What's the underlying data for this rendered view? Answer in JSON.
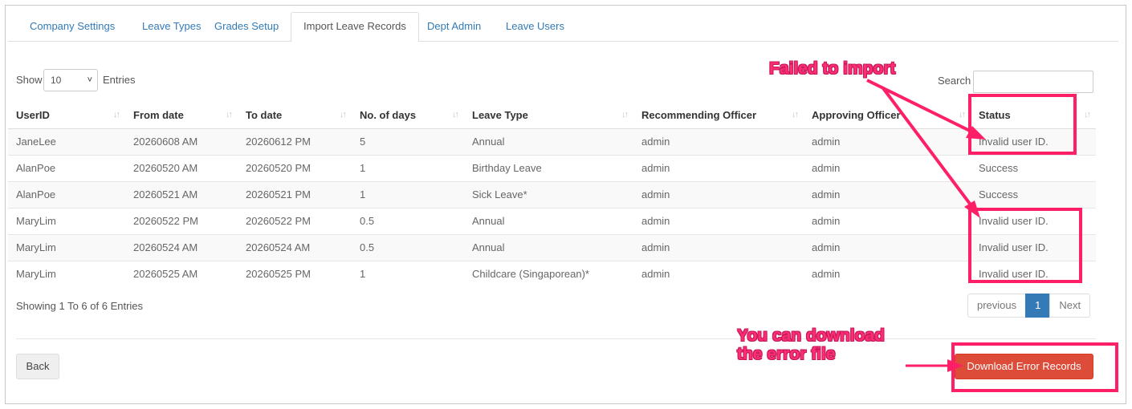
{
  "tabs": [
    {
      "label": "Company Settings",
      "active": false
    },
    {
      "label": "Leave Types",
      "active": false
    },
    {
      "label": "Grades Setup",
      "active": false
    },
    {
      "label": "Import Leave Records",
      "active": true
    },
    {
      "label": "Dept Admin",
      "active": false
    },
    {
      "label": "Leave Users",
      "active": false
    }
  ],
  "length_control": {
    "label_before": "Show",
    "value": "10",
    "label_after": "Entries"
  },
  "search": {
    "label": "Search",
    "value": ""
  },
  "table": {
    "columns": [
      "UserID",
      "From date",
      "To date",
      "No. of days",
      "Leave Type",
      "Recommending Officer",
      "Approving Officer",
      "Status"
    ],
    "rows": [
      [
        "JaneLee",
        "20260608 AM",
        "20260612 PM",
        "5",
        "Annual",
        "admin",
        "admin",
        "Invalid user ID."
      ],
      [
        "AlanPoe",
        "20260520 AM",
        "20260520 PM",
        "1",
        "Birthday Leave",
        "admin",
        "admin",
        "Success"
      ],
      [
        "AlanPoe",
        "20260521 AM",
        "20260521 PM",
        "1",
        "Sick Leave*",
        "admin",
        "admin",
        "Success"
      ],
      [
        "MaryLim",
        "20260522 PM",
        "20260522 PM",
        "0.5",
        "Annual",
        "admin",
        "admin",
        "Invalid user ID."
      ],
      [
        "MaryLim",
        "20260524 AM",
        "20260524 AM",
        "0.5",
        "Annual",
        "admin",
        "admin",
        "Invalid user ID."
      ],
      [
        "MaryLim",
        "20260525 AM",
        "20260525 PM",
        "1",
        "Childcare (Singaporean)*",
        "admin",
        "admin",
        "Invalid user ID."
      ]
    ]
  },
  "info": "Showing 1 To 6 of 6 Entries",
  "pagination": {
    "previous": "previous",
    "current": "1",
    "next": "Next"
  },
  "buttons": {
    "back": "Back",
    "download": "Download Error Records"
  },
  "annotations": {
    "failed": "Failed to import",
    "download_line1": "You can download",
    "download_line2": "the error file"
  },
  "colors": {
    "accent": "#337ab7",
    "danger": "#dd4b39",
    "annotation": "#ff1f66"
  }
}
